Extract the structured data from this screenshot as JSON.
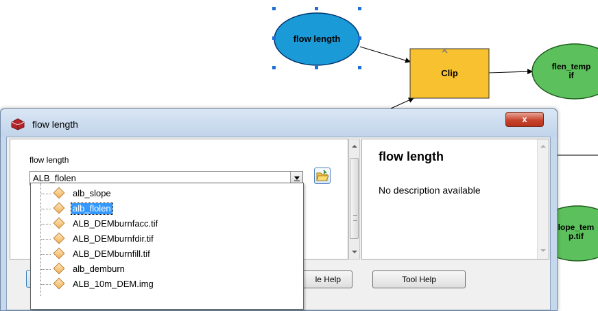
{
  "model": {
    "nodes": {
      "flow_length": "flow length",
      "clip": "Clip",
      "flen_temp": "flen_temp\nif",
      "slope_temp": "lope_tem\np.tif"
    }
  },
  "dialog": {
    "title": "flow length",
    "close_label": "x",
    "param_label": "flow length",
    "param_value": "ALB_flolen",
    "help_title": "flow length",
    "help_description": "No description available",
    "buttons": {
      "hide_help": "le Help",
      "tool_help": "Tool Help"
    }
  },
  "dropdown": {
    "items": [
      {
        "label": "alb_slope",
        "selected": false
      },
      {
        "label": "alb_flolen",
        "selected": true
      },
      {
        "label": "ALB_DEMburnfacc.tif",
        "selected": false
      },
      {
        "label": "ALB_DEMburnfdir.tif",
        "selected": false
      },
      {
        "label": "ALB_DEMburnfill.tif",
        "selected": false
      },
      {
        "label": "alb_demburn",
        "selected": false
      },
      {
        "label": "ALB_10m_DEM.img",
        "selected": false
      }
    ]
  },
  "colors": {
    "input_node": "#1a9ad7",
    "tool_node": "#f7c12f",
    "output_node": "#5cc15c",
    "selection": "#3399ff"
  }
}
